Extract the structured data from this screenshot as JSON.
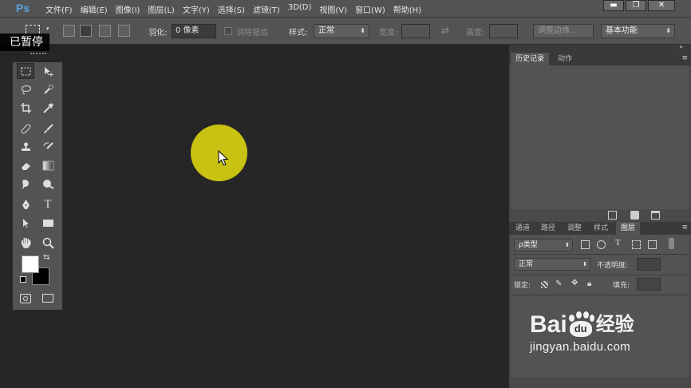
{
  "app": {
    "logo": "Ps"
  },
  "menu": [
    "文件(F)",
    "编辑(E)",
    "图像(I)",
    "图层(L)",
    "文字(Y)",
    "选择(S)",
    "滤镜(T)",
    "3D(D)",
    "视图(V)",
    "窗口(W)",
    "帮助(H)"
  ],
  "window_controls": {
    "minimize": "▬",
    "maximize": "❐",
    "close": "✕"
  },
  "overlay": {
    "paused": "已暂停"
  },
  "options": {
    "feather_label": "羽化:",
    "feather_value": "0 像素",
    "antialias_label": "消除锯齿",
    "style_label": "样式:",
    "style_value": "正常",
    "width_label": "宽度:",
    "height_label": "高度:",
    "refine_edge": "调整边缘...",
    "workspace": "基本功能"
  },
  "panels": {
    "history_tabs": [
      "历史记录",
      "动作"
    ],
    "layers_tabs": [
      "通道",
      "路径",
      "调整",
      "样式",
      "图层"
    ],
    "filter_kind": "ρ类型",
    "blend_mode": "正常",
    "opacity_label": "不透明度:",
    "lock_label": "锁定:",
    "fill_label": "填充:"
  },
  "toolbox": {
    "text_tool_glyph": "T"
  },
  "watermark": {
    "brand": "Bai",
    "brand_after": "经验",
    "paw_text": "du",
    "url": "jingyan.baidu.com"
  },
  "colors": {
    "cursor_halo": "#c8c312",
    "ps_blue": "#5ba2e0",
    "foreground": "#ffffff",
    "background": "#000000"
  }
}
